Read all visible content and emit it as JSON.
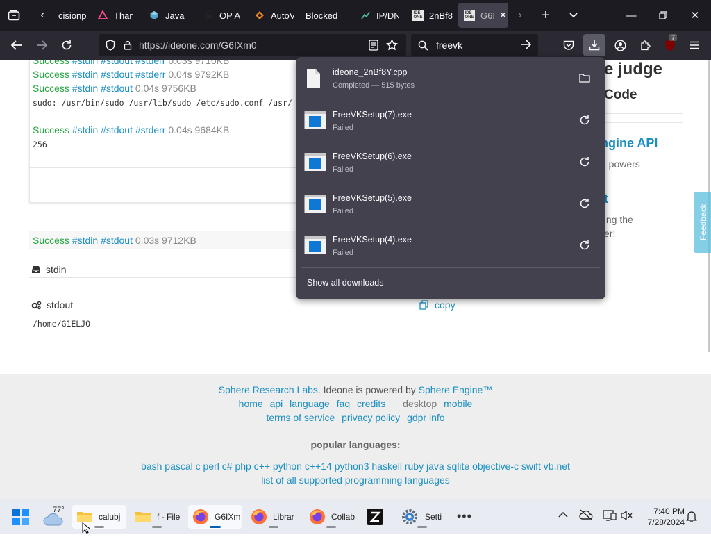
{
  "tabs": [
    {
      "label": "cisionp",
      "icon": "document-icon"
    },
    {
      "label": "Thank",
      "icon": "triangle-logo-icon"
    },
    {
      "label": "Java E",
      "icon": "cube-icon"
    },
    {
      "label": "OP Au",
      "icon": "lock-icon"
    },
    {
      "label": "AutoV",
      "icon": "diamond-icon"
    },
    {
      "label": "Blocked",
      "icon": "blocked-icon"
    },
    {
      "label": "IP/DN",
      "icon": "network-icon"
    },
    {
      "label": "2nBf8",
      "icon": "ideone-icon"
    },
    {
      "label": "G6I",
      "icon": "ideone-icon",
      "active": true
    }
  ],
  "url": "https://ideone.com/G6IXm0",
  "search_value": "freevk",
  "extensions_badge": "7",
  "page": {
    "results": [
      {
        "status": "Success",
        "links": [
          "#stdin",
          "#stdout",
          "#stderr"
        ],
        "time": "0.03s",
        "mem": "9716KB"
      },
      {
        "status": "Success",
        "links": [
          "#stdin",
          "#stdout",
          "#stderr"
        ],
        "time": "0.04s",
        "mem": "9792KB"
      },
      {
        "status": "Success",
        "links": [
          "#stdin",
          "#stdout"
        ],
        "time": "0.04s",
        "mem": "9756KB"
      },
      {
        "status": "Success",
        "links": [
          "#stdin",
          "#stdout",
          "#stderr"
        ],
        "time": "0.04s",
        "mem": "9684KB"
      },
      {
        "status": "Success",
        "links": [
          "#stdin",
          "#stdout"
        ],
        "time": "0.03s",
        "mem": "9712KB"
      }
    ],
    "sudo_line": "sudo: /usr/bin/sudo /usr/lib/sudo /etc/sudo.conf /usr/",
    "number_output": "256",
    "stdin_label": "stdin",
    "stdout_label": "stdout",
    "copy_label": "copy",
    "stdout_value": "/home/G1ELJO",
    "sidebar": {
      "heading_a": "e judge",
      "heading_b": "Code",
      "engine_api": "ngine API",
      "engine_text": "n powers",
      "heading_t": "t",
      "learning_a": "ning the",
      "learning_b": "er!"
    },
    "feedback": "Feedback"
  },
  "footer": {
    "line1_a": "Sphere Research Labs",
    "line1_b": ". Ideone is powered by ",
    "line1_c": "Sphere Engine™",
    "links1": [
      "home",
      "api",
      "language",
      "faq",
      "credits"
    ],
    "desktop": "desktop",
    "mobile": "mobile",
    "links2": [
      "terms of service",
      "privacy policy",
      "gdpr info"
    ],
    "popular_heading": "popular languages:",
    "languages": "bash pascal c perl c# php c++ python c++14 python3 haskell ruby java sqlite objective-c swift vb.net",
    "all_languages": "list of all supported programming languages"
  },
  "downloads": {
    "items": [
      {
        "name": "ideone_2nBf8Y.cpp",
        "status": "Completed — 515 bytes",
        "kind": "file",
        "action": "folder-icon"
      },
      {
        "name": "FreeVKSetup(7).exe",
        "status": "Failed",
        "kind": "exe",
        "action": "retry-icon"
      },
      {
        "name": "FreeVKSetup(6).exe",
        "status": "Failed",
        "kind": "exe",
        "action": "retry-icon"
      },
      {
        "name": "FreeVKSetup(5).exe",
        "status": "Failed",
        "kind": "exe",
        "action": "retry-icon"
      },
      {
        "name": "FreeVKSetup(4).exe",
        "status": "Failed",
        "kind": "exe",
        "action": "retry-icon"
      }
    ],
    "show_all": "Show all downloads"
  },
  "taskbar": {
    "weather": "77°",
    "apps": [
      {
        "label": "calubj",
        "icon": "folder-icon"
      },
      {
        "label": "f - File",
        "icon": "folder-icon"
      },
      {
        "label": "G6IXm",
        "icon": "firefox-icon",
        "active": true
      },
      {
        "label": "Librar",
        "icon": "firefox-icon"
      },
      {
        "label": "Collab",
        "icon": "firefox-icon"
      },
      {
        "label": "",
        "icon": "z-app-icon"
      },
      {
        "label": "Setti",
        "icon": "settings-icon"
      }
    ],
    "time": "7:40 PM",
    "date": "7/28/2024"
  }
}
